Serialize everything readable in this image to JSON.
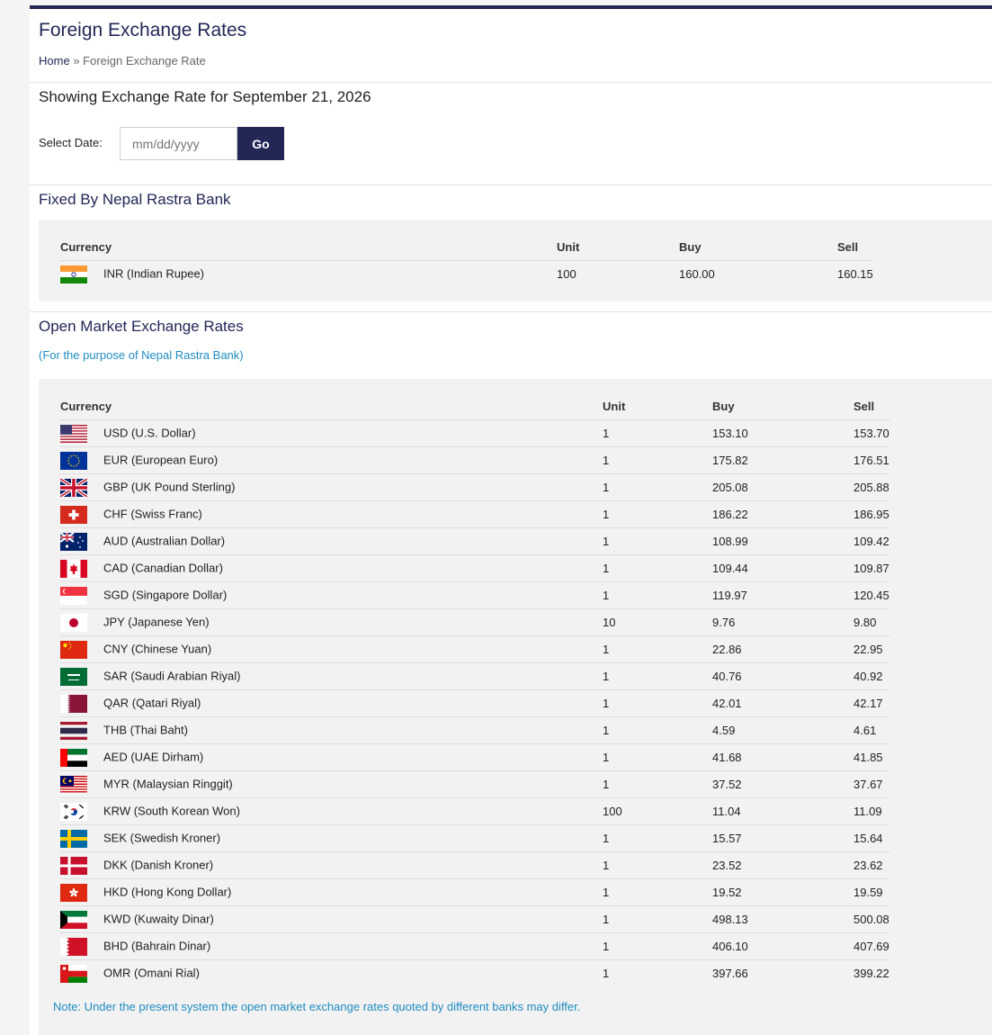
{
  "header": {
    "title": "Foreign Exchange Rates",
    "breadcrumb_home": "Home",
    "breadcrumb_sep": "»",
    "breadcrumb_current": "Foreign Exchange Rate"
  },
  "date_section": {
    "heading": "Showing Exchange Rate for September 21, 2026",
    "label": "Select Date:",
    "placeholder": "mm/dd/yyyy",
    "go_label": "Go"
  },
  "fixed": {
    "title": "Fixed By Nepal Rastra Bank",
    "headers": [
      "Currency",
      "Unit",
      "Buy",
      "Sell"
    ],
    "rows": [
      {
        "flag": "inr",
        "currency": "INR (Indian Rupee)",
        "unit": "100",
        "buy": "160.00",
        "sell": "160.15"
      }
    ]
  },
  "open_market": {
    "title": "Open Market Exchange Rates",
    "subtitle": "(For the purpose of Nepal Rastra Bank)",
    "headers": [
      "Currency",
      "Unit",
      "Buy",
      "Sell"
    ],
    "rows": [
      {
        "flag": "usd",
        "currency": "USD (U.S. Dollar)",
        "unit": "1",
        "buy": "153.10",
        "sell": "153.70"
      },
      {
        "flag": "eur",
        "currency": "EUR (European Euro)",
        "unit": "1",
        "buy": "175.82",
        "sell": "176.51"
      },
      {
        "flag": "gbp",
        "currency": "GBP (UK Pound Sterling)",
        "unit": "1",
        "buy": "205.08",
        "sell": "205.88"
      },
      {
        "flag": "chf",
        "currency": "CHF (Swiss Franc)",
        "unit": "1",
        "buy": "186.22",
        "sell": "186.95"
      },
      {
        "flag": "aud",
        "currency": "AUD (Australian Dollar)",
        "unit": "1",
        "buy": "108.99",
        "sell": "109.42"
      },
      {
        "flag": "cad",
        "currency": "CAD (Canadian Dollar)",
        "unit": "1",
        "buy": "109.44",
        "sell": "109.87"
      },
      {
        "flag": "sgd",
        "currency": "SGD (Singapore Dollar)",
        "unit": "1",
        "buy": "119.97",
        "sell": "120.45"
      },
      {
        "flag": "jpy",
        "currency": "JPY (Japanese Yen)",
        "unit": "10",
        "buy": "9.76",
        "sell": "9.80"
      },
      {
        "flag": "cny",
        "currency": "CNY (Chinese Yuan)",
        "unit": "1",
        "buy": "22.86",
        "sell": "22.95"
      },
      {
        "flag": "sar",
        "currency": "SAR (Saudi Arabian Riyal)",
        "unit": "1",
        "buy": "40.76",
        "sell": "40.92"
      },
      {
        "flag": "qar",
        "currency": "QAR (Qatari Riyal)",
        "unit": "1",
        "buy": "42.01",
        "sell": "42.17"
      },
      {
        "flag": "thb",
        "currency": "THB (Thai Baht)",
        "unit": "1",
        "buy": "4.59",
        "sell": "4.61"
      },
      {
        "flag": "aed",
        "currency": "AED (UAE Dirham)",
        "unit": "1",
        "buy": "41.68",
        "sell": "41.85"
      },
      {
        "flag": "myr",
        "currency": "MYR (Malaysian Ringgit)",
        "unit": "1",
        "buy": "37.52",
        "sell": "37.67"
      },
      {
        "flag": "krw",
        "currency": "KRW (South Korean Won)",
        "unit": "100",
        "buy": "11.04",
        "sell": "11.09"
      },
      {
        "flag": "sek",
        "currency": "SEK (Swedish Kroner)",
        "unit": "1",
        "buy": "15.57",
        "sell": "15.64"
      },
      {
        "flag": "dkk",
        "currency": "DKK (Danish Kroner)",
        "unit": "1",
        "buy": "23.52",
        "sell": "23.62"
      },
      {
        "flag": "hkd",
        "currency": "HKD (Hong Kong Dollar)",
        "unit": "1",
        "buy": "19.52",
        "sell": "19.59"
      },
      {
        "flag": "kwd",
        "currency": "KWD (Kuwaity Dinar)",
        "unit": "1",
        "buy": "498.13",
        "sell": "500.08"
      },
      {
        "flag": "bhd",
        "currency": "BHD (Bahrain Dinar)",
        "unit": "1",
        "buy": "406.10",
        "sell": "407.69"
      },
      {
        "flag": "omr",
        "currency": "OMR (Omani Rial)",
        "unit": "1",
        "buy": "397.66",
        "sell": "399.22"
      }
    ],
    "note": "Note: Under the present system the open market exchange rates quoted by different banks may differ."
  },
  "colors": {
    "brand_navy": "#232756",
    "note_blue": "#1f8cc0"
  }
}
